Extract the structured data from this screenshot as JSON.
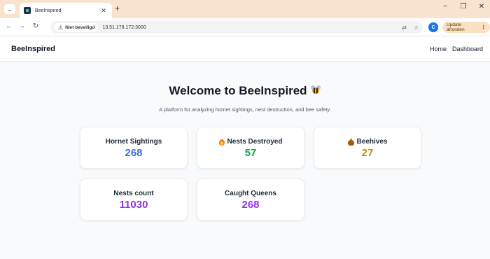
{
  "browser": {
    "tab_title": "BeeInspired",
    "tab_close": "✕",
    "new_tab": "+",
    "address_warning": "Niet beveiligd",
    "url": "13.51.178.172:3000",
    "profile_initial": "C",
    "update_label": "Update afronden",
    "window_minimize": "−",
    "window_restore": "❐",
    "window_close": "✕"
  },
  "header": {
    "brand": "BeeInspired",
    "nav": [
      "Home",
      "Dashboard"
    ]
  },
  "hero": {
    "title": "Welcome to BeeInspired",
    "subtitle": "A platform for analyzing hornet sightings, nest destruction, and bee safety."
  },
  "stats": [
    {
      "label": "Hornet Sightings",
      "value": "268",
      "icon": "none",
      "color": "#3b6fd8"
    },
    {
      "label": "Nests Destroyed",
      "value": "57",
      "icon": "fire-icon",
      "color": "#16a34a"
    },
    {
      "label": "Beehives",
      "value": "27",
      "icon": "beehive-icon",
      "color": "#ca8a04"
    },
    {
      "label": "Nests count",
      "value": "11030",
      "icon": "none",
      "color": "#9333ea"
    },
    {
      "label": "Caught Queens",
      "value": "268",
      "icon": "none",
      "color": "#9333ea"
    }
  ],
  "colors": {
    "tabstrip": "#f8e3cf",
    "background": "#f9fafb",
    "text": "#111827"
  }
}
